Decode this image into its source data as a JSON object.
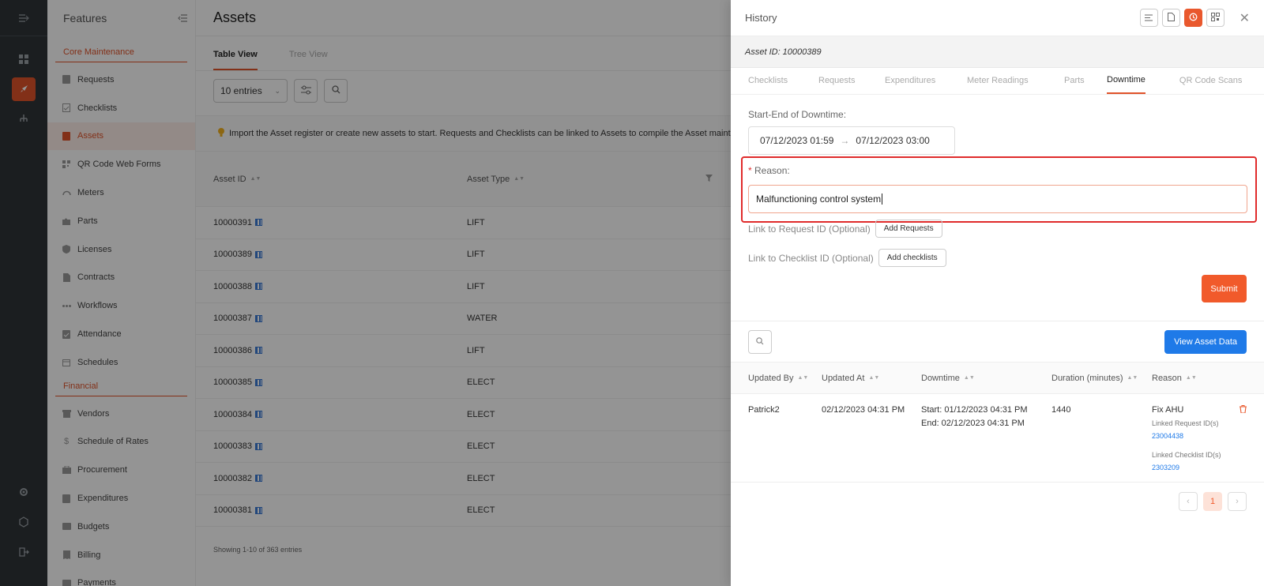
{
  "features": {
    "title": "Features",
    "sections": [
      {
        "title": "Core Maintenance",
        "items": [
          "Requests",
          "Checklists",
          "Assets",
          "QR Code Web Forms",
          "Meters",
          "Parts",
          "Licenses",
          "Contracts",
          "Workflows",
          "Attendance",
          "Schedules"
        ]
      },
      {
        "title": "Financial",
        "items": [
          "Vendors",
          "Schedule of Rates",
          "Procurement",
          "Expenditures",
          "Budgets",
          "Billing",
          "Payments"
        ]
      }
    ],
    "active_item": "Assets"
  },
  "main": {
    "title": "Assets",
    "tabs": [
      "Table View",
      "Tree View"
    ],
    "entries_select": "10 entries",
    "notice": "Import the Asset register or create new assets to start. Requests and Checklists can be linked to Assets to compile the Asset maintenance l",
    "columns": [
      "Asset ID",
      "Asset Type"
    ],
    "rows": [
      {
        "id": "10000391",
        "type": "LIFT"
      },
      {
        "id": "10000389",
        "type": "LIFT"
      },
      {
        "id": "10000388",
        "type": "LIFT"
      },
      {
        "id": "10000387",
        "type": "WATER"
      },
      {
        "id": "10000386",
        "type": "LIFT"
      },
      {
        "id": "10000385",
        "type": "ELECT"
      },
      {
        "id": "10000384",
        "type": "ELECT"
      },
      {
        "id": "10000383",
        "type": "ELECT"
      },
      {
        "id": "10000382",
        "type": "ELECT"
      },
      {
        "id": "10000381",
        "type": "ELECT"
      }
    ],
    "showing": "Showing 1-10 of 363 entries"
  },
  "drawer": {
    "title": "History",
    "asset_id": "Asset ID: 10000389",
    "tabs": [
      "Checklists",
      "Requests",
      "Expenditures",
      "Meter Readings",
      "Parts",
      "Downtime",
      "QR Code Scans"
    ],
    "active_tab": "Downtime",
    "form": {
      "range_label": "Start-End of Downtime",
      "start": "07/12/2023 01:59",
      "range_sep": "→",
      "end": "07/12/2023 03:00",
      "reason_label": "Reason",
      "required_mark": "*",
      "reason_value": "Malfunctioning control system",
      "link_request_label": "Link to Request ID (Optional)",
      "add_requests": "Add Requests",
      "link_checklist_label": "Link to Checklist ID (Optional)",
      "add_checklists": "Add checklists",
      "submit": "Submit"
    },
    "view_asset_data": "View Asset Data",
    "history_columns": [
      "Updated By",
      "Updated At",
      "Downtime",
      "Duration (minutes)",
      "Reason"
    ],
    "history_rows": [
      {
        "updated_by": "Patrick2",
        "updated_at": "02/12/2023 04:31 PM",
        "start": "Start: 01/12/2023 04:31 PM",
        "end": "End: 02/12/2023 04:31 PM",
        "duration": "1440",
        "reason": "Fix AHU",
        "linked_request_label": "Linked Request ID(s)",
        "linked_request": "23004438",
        "linked_checklist_label": "Linked Checklist ID(s)",
        "linked_checklist": "2303209"
      }
    ],
    "page": "1"
  },
  "colors": {
    "accent": "#e0532a",
    "primary_blue": "#1f7ae8",
    "error": "#e02b2b"
  }
}
